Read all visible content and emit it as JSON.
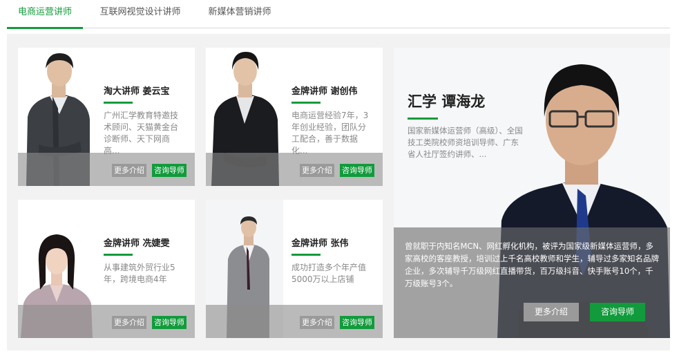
{
  "tabs": [
    {
      "label": "电商运营讲师"
    },
    {
      "label": "互联网视觉设计讲师"
    },
    {
      "label": "新媒体营销讲师"
    }
  ],
  "colors": {
    "accent": "#129b3c",
    "muted_button": "#9a9a9a"
  },
  "cards": [
    {
      "title": "淘大讲师 姜云宝",
      "desc": "广州汇学教育特邀技术顾问、天猫黄金台诊断师、天下网商高...",
      "more": "更多介绍",
      "consult": "咨询导师"
    },
    {
      "title": "金牌讲师 谢创伟",
      "desc": "电商运营经验7年，3年创业经验，团队分工配合，善于数据化...",
      "more": "更多介绍",
      "consult": "咨询导师"
    },
    {
      "title": "金牌讲师 冼婕雯",
      "desc": "从事建筑外贸行业5年，跨境电商4年",
      "more": "更多介绍",
      "consult": "咨询导师"
    },
    {
      "title": "金牌讲师 张伟",
      "desc": "成功打造多个年产值5000万以上店铺",
      "more": "更多介绍",
      "consult": "咨询导师"
    }
  ],
  "featured": {
    "title": "汇学 谭海龙",
    "desc": "国家新媒体运营师（高级）、全国技工类院校师资培训导师、广东省人社厅签约讲师、...",
    "bio": "曾就职于内知名MCN、网红孵化机构，被评为国家级新媒体运营师，多家高校的客座教授，培训过上千名高校教师和学生，辅导过多家知名品牌企业，多次辅导千万级网红直播带货，百万级抖音、快手账号10个，千万级账号3个。",
    "more": "更多介绍",
    "consult": "咨询导师"
  }
}
